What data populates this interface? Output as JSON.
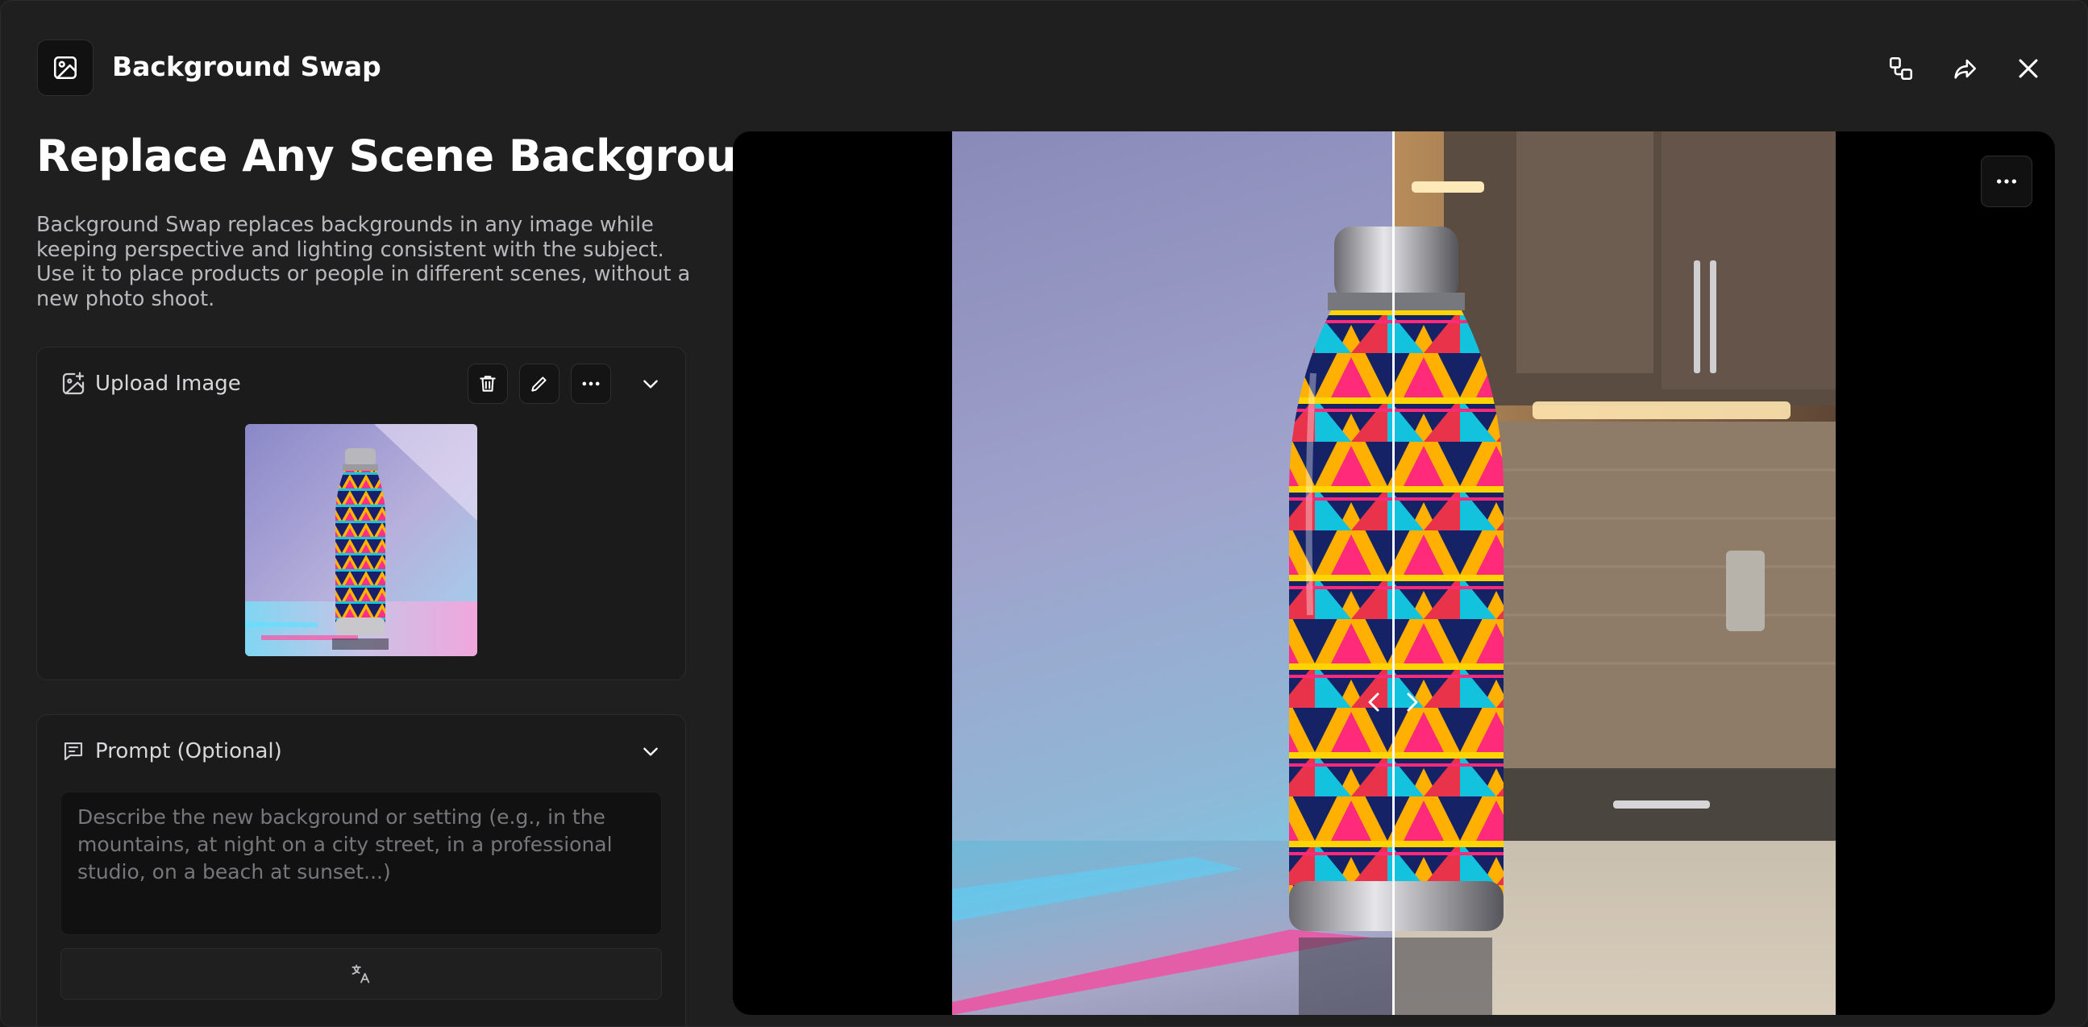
{
  "header": {
    "app_title": "Background Swap",
    "app_icon": "image-icon",
    "actions": [
      "compare-icon",
      "share-icon",
      "close-icon"
    ]
  },
  "main": {
    "title": "Replace Any Scene Background",
    "description": "Background Swap replaces backgrounds in any image while keeping perspective and lighting consistent with the subject. Use it to place products or people in different scenes, without a new photo shoot."
  },
  "upload": {
    "label": "Upload Image",
    "icon": "image-add-icon",
    "tools": [
      "trash-icon",
      "pencil-icon",
      "more-icon",
      "chevron-down-icon"
    ]
  },
  "prompt": {
    "label": "Prompt (Optional)",
    "icon": "message-icon",
    "placeholder": "Describe the new background or setting (e.g., in the mountains, at night on a city street, in a professional studio, on a beach at sunset...)",
    "value": "",
    "translate_icon": "translate-icon"
  },
  "preview": {
    "slider_position": 0.5,
    "more_icon": "more-icon"
  },
  "colors": {
    "background": "#1f1f20",
    "panel": "#1b1b1c",
    "text_primary": "#ffffff",
    "text_secondary": "#b9b9bd"
  }
}
